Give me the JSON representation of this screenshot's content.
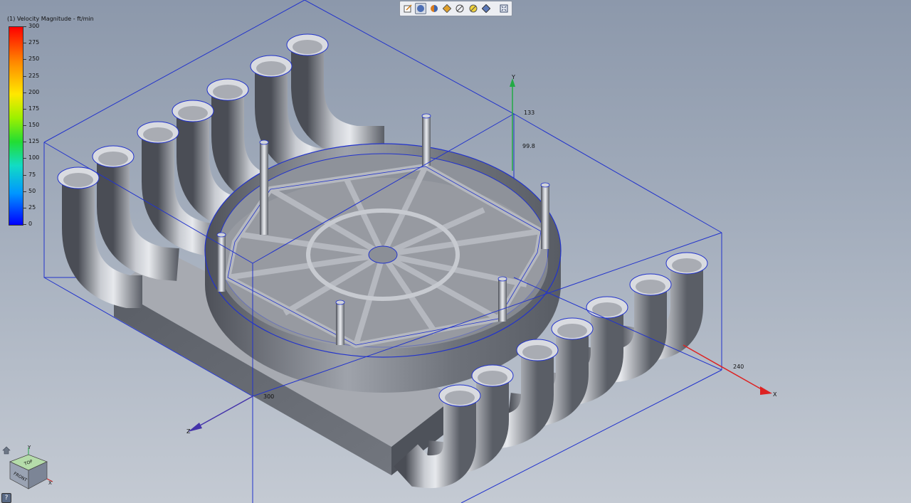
{
  "toolbar": {
    "buttons": [
      {
        "name": "edit-icon"
      },
      {
        "name": "shaded-view-icon",
        "active": true
      },
      {
        "name": "color-shade-icon"
      },
      {
        "name": "orange-shade-icon"
      },
      {
        "name": "outline-icon"
      },
      {
        "name": "yellow-outline-icon"
      },
      {
        "name": "blue-shade-icon"
      },
      {
        "name": "fit-view-icon"
      }
    ]
  },
  "legend": {
    "title": "(1) Velocity Magnitude - ft/min",
    "ticks": [
      "300",
      "275",
      "250",
      "225",
      "200",
      "175",
      "150",
      "125",
      "100",
      "75",
      "50",
      "25",
      "0"
    ],
    "colors": [
      "#ff0000",
      "#ff8a00",
      "#ffe800",
      "#22dd33",
      "#12dcc4",
      "#0096ff",
      "#0000ff"
    ],
    "min": 0,
    "max": 300
  },
  "axes": {
    "y_top": "133",
    "y_mid": "99.8",
    "y_letter": "Y",
    "x_value": "240",
    "x_letter": "X",
    "z_value": "300",
    "z_letter": "Z"
  },
  "viewcube": {
    "top_face": "TOP",
    "front_face": "FRONT",
    "y_letter": "Y",
    "x_letter": "X"
  },
  "help": "?"
}
